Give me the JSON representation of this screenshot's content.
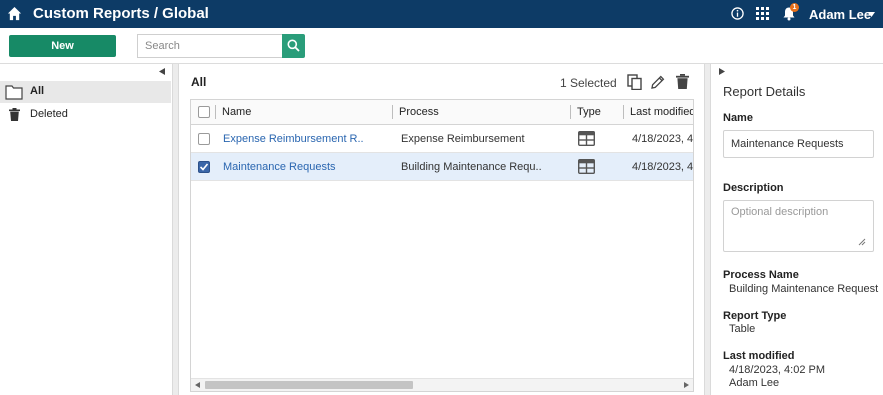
{
  "header": {
    "title": "Custom Reports / Global",
    "notification_count": "1",
    "user_name": "Adam Lee",
    "bar_color": "#0d3b66"
  },
  "toolbar": {
    "new_label": "New",
    "search_placeholder": "Search",
    "accent_color": "#178a66"
  },
  "sidebar": {
    "items": [
      {
        "label": "All",
        "icon": "folder-icon",
        "active": true
      },
      {
        "label": "Deleted",
        "icon": "trash-icon",
        "active": false
      }
    ]
  },
  "main": {
    "heading": "All",
    "selected_text": "1 Selected",
    "columns": [
      "Name",
      "Process",
      "Type",
      "Last modified"
    ],
    "rows": [
      {
        "name": "Expense Reimbursement R...",
        "process": "Expense Reimbursement",
        "type": "table-icon",
        "modified": "4/18/2023, 4:",
        "checked": false
      },
      {
        "name": "Maintenance Requests",
        "process": "Building Maintenance Requ...",
        "type": "table-icon",
        "modified": "4/18/2023, 4:",
        "checked": true
      }
    ]
  },
  "details": {
    "title": "Report Details",
    "name_label": "Name",
    "name_value": "Maintenance Requests",
    "description_label": "Description",
    "description_placeholder": "Optional description",
    "process_name_label": "Process Name",
    "process_name_value": "Building Maintenance Request",
    "report_type_label": "Report Type",
    "report_type_value": "Table",
    "last_modified_label": "Last modified",
    "last_modified_value": "4/18/2023, 4:02 PM",
    "last_modified_by": "Adam Lee"
  }
}
